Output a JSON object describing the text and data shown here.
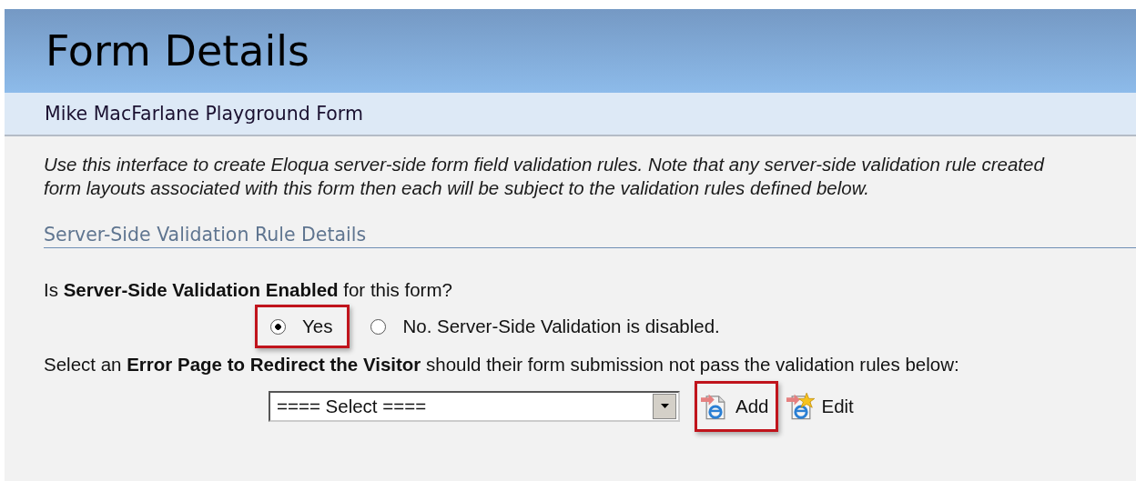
{
  "header": {
    "title": "Form Details",
    "subtitle": "Mike MacFarlane Playground Form"
  },
  "description": "Use this interface to create Eloqua server-side form field validation rules. Note that any server-side validation rule created\nform layouts associated with this form then each will be subject to the validation rules defined below.",
  "section": {
    "title": "Server-Side Validation Rule Details"
  },
  "enabled_question": "Is **Server-Side Validation Enabled** for this form?",
  "enabled_options": [
    {
      "label": "Yes",
      "selected": true,
      "highlighted": true
    },
    {
      "label": "No. Server-Side Validation is disabled.",
      "selected": false,
      "highlighted": false
    }
  ],
  "error_page_question": "Select an **Error Page to Redirect the Visitor** should their form submission not pass the validation rules below:",
  "error_page_select": {
    "value": "==== Select ===="
  },
  "error_page_buttons": [
    {
      "label": "Add",
      "kind": "add",
      "highlighted": true
    },
    {
      "label": "Edit",
      "kind": "edit",
      "highlighted": false
    }
  ]
}
